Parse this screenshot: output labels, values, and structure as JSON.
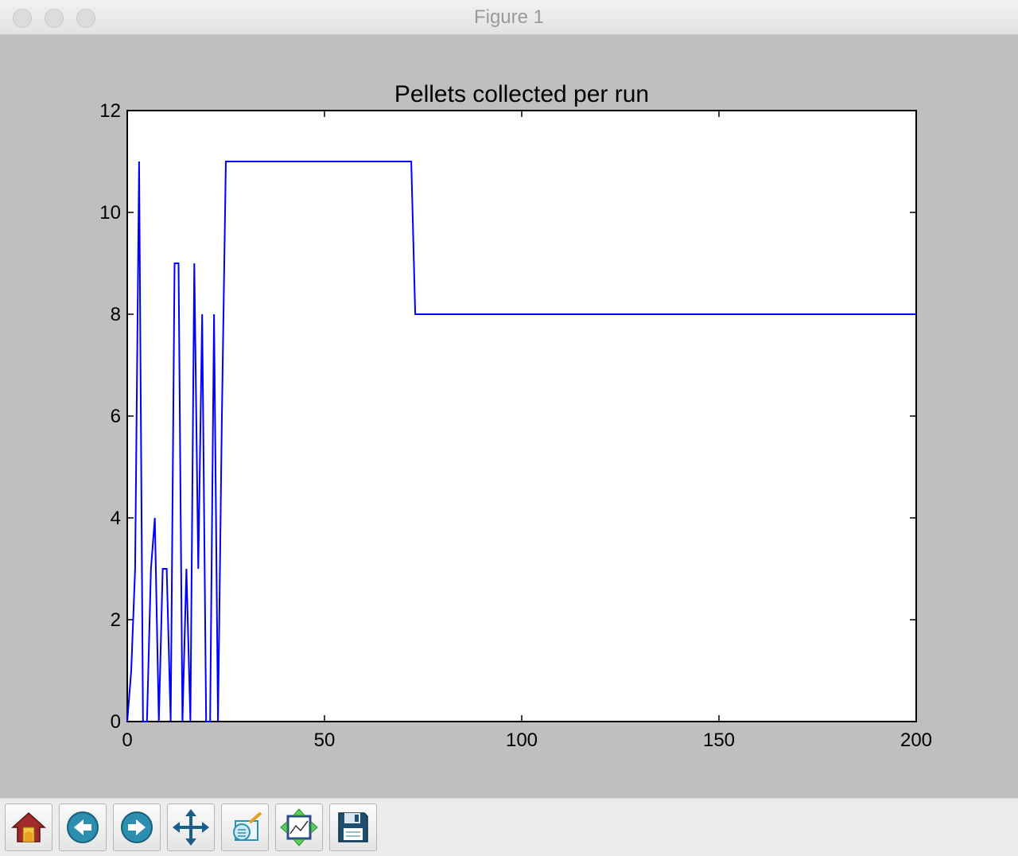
{
  "window": {
    "title": "Figure 1"
  },
  "toolbar": {
    "buttons": [
      {
        "name": "home-button",
        "icon": "home-icon"
      },
      {
        "name": "back-button",
        "icon": "back-arrow-icon"
      },
      {
        "name": "forward-button",
        "icon": "forward-arrow-icon"
      },
      {
        "name": "pan-button",
        "icon": "move-arrows-icon"
      },
      {
        "name": "zoom-button",
        "icon": "zoom-rect-icon"
      },
      {
        "name": "subplots-button",
        "icon": "subplots-config-icon"
      },
      {
        "name": "save-button",
        "icon": "floppy-disk-icon"
      }
    ]
  },
  "colors": {
    "line": "#0000ff",
    "canvas_bg": "#bfbfbf",
    "plot_bg": "#ffffff"
  },
  "chart_data": {
    "type": "line",
    "title": "Pellets collected per run",
    "xlabel": "",
    "ylabel": "",
    "xlim": [
      0,
      200
    ],
    "ylim": [
      0,
      12
    ],
    "xticks": [
      0,
      50,
      100,
      150,
      200
    ],
    "yticks": [
      0,
      2,
      4,
      6,
      8,
      10,
      12
    ],
    "grid": false,
    "series": [
      {
        "x": [
          0,
          1,
          2,
          3,
          4,
          5,
          6,
          7,
          8,
          9,
          10,
          11,
          12,
          13,
          14,
          15,
          16,
          17,
          18,
          19,
          20,
          21,
          22,
          23,
          24,
          25,
          72,
          73,
          200
        ],
        "y": [
          0,
          1,
          3,
          11,
          0,
          0,
          3,
          4,
          0,
          3,
          3,
          0,
          9,
          9,
          0,
          3,
          0,
          9,
          3,
          8,
          0,
          0,
          8,
          0,
          6,
          11,
          11,
          8,
          8
        ]
      }
    ]
  }
}
